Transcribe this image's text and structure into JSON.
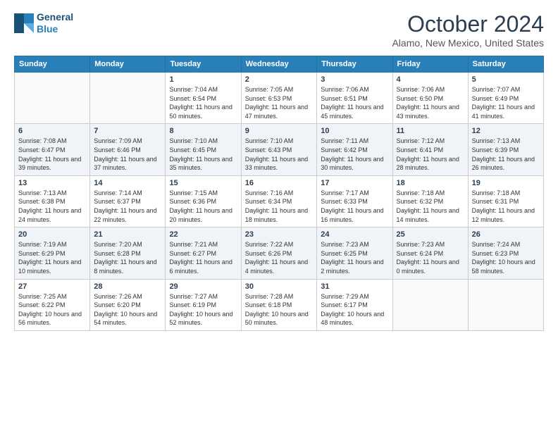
{
  "header": {
    "logo_general": "General",
    "logo_blue": "Blue",
    "month": "October 2024",
    "location": "Alamo, New Mexico, United States"
  },
  "weekdays": [
    "Sunday",
    "Monday",
    "Tuesday",
    "Wednesday",
    "Thursday",
    "Friday",
    "Saturday"
  ],
  "weeks": [
    [
      {
        "day": "",
        "info": ""
      },
      {
        "day": "",
        "info": ""
      },
      {
        "day": "1",
        "info": "Sunrise: 7:04 AM\nSunset: 6:54 PM\nDaylight: 11 hours and 50 minutes."
      },
      {
        "day": "2",
        "info": "Sunrise: 7:05 AM\nSunset: 6:53 PM\nDaylight: 11 hours and 47 minutes."
      },
      {
        "day": "3",
        "info": "Sunrise: 7:06 AM\nSunset: 6:51 PM\nDaylight: 11 hours and 45 minutes."
      },
      {
        "day": "4",
        "info": "Sunrise: 7:06 AM\nSunset: 6:50 PM\nDaylight: 11 hours and 43 minutes."
      },
      {
        "day": "5",
        "info": "Sunrise: 7:07 AM\nSunset: 6:49 PM\nDaylight: 11 hours and 41 minutes."
      }
    ],
    [
      {
        "day": "6",
        "info": "Sunrise: 7:08 AM\nSunset: 6:47 PM\nDaylight: 11 hours and 39 minutes."
      },
      {
        "day": "7",
        "info": "Sunrise: 7:09 AM\nSunset: 6:46 PM\nDaylight: 11 hours and 37 minutes."
      },
      {
        "day": "8",
        "info": "Sunrise: 7:10 AM\nSunset: 6:45 PM\nDaylight: 11 hours and 35 minutes."
      },
      {
        "day": "9",
        "info": "Sunrise: 7:10 AM\nSunset: 6:43 PM\nDaylight: 11 hours and 33 minutes."
      },
      {
        "day": "10",
        "info": "Sunrise: 7:11 AM\nSunset: 6:42 PM\nDaylight: 11 hours and 30 minutes."
      },
      {
        "day": "11",
        "info": "Sunrise: 7:12 AM\nSunset: 6:41 PM\nDaylight: 11 hours and 28 minutes."
      },
      {
        "day": "12",
        "info": "Sunrise: 7:13 AM\nSunset: 6:39 PM\nDaylight: 11 hours and 26 minutes."
      }
    ],
    [
      {
        "day": "13",
        "info": "Sunrise: 7:13 AM\nSunset: 6:38 PM\nDaylight: 11 hours and 24 minutes."
      },
      {
        "day": "14",
        "info": "Sunrise: 7:14 AM\nSunset: 6:37 PM\nDaylight: 11 hours and 22 minutes."
      },
      {
        "day": "15",
        "info": "Sunrise: 7:15 AM\nSunset: 6:36 PM\nDaylight: 11 hours and 20 minutes."
      },
      {
        "day": "16",
        "info": "Sunrise: 7:16 AM\nSunset: 6:34 PM\nDaylight: 11 hours and 18 minutes."
      },
      {
        "day": "17",
        "info": "Sunrise: 7:17 AM\nSunset: 6:33 PM\nDaylight: 11 hours and 16 minutes."
      },
      {
        "day": "18",
        "info": "Sunrise: 7:18 AM\nSunset: 6:32 PM\nDaylight: 11 hours and 14 minutes."
      },
      {
        "day": "19",
        "info": "Sunrise: 7:18 AM\nSunset: 6:31 PM\nDaylight: 11 hours and 12 minutes."
      }
    ],
    [
      {
        "day": "20",
        "info": "Sunrise: 7:19 AM\nSunset: 6:29 PM\nDaylight: 11 hours and 10 minutes."
      },
      {
        "day": "21",
        "info": "Sunrise: 7:20 AM\nSunset: 6:28 PM\nDaylight: 11 hours and 8 minutes."
      },
      {
        "day": "22",
        "info": "Sunrise: 7:21 AM\nSunset: 6:27 PM\nDaylight: 11 hours and 6 minutes."
      },
      {
        "day": "23",
        "info": "Sunrise: 7:22 AM\nSunset: 6:26 PM\nDaylight: 11 hours and 4 minutes."
      },
      {
        "day": "24",
        "info": "Sunrise: 7:23 AM\nSunset: 6:25 PM\nDaylight: 11 hours and 2 minutes."
      },
      {
        "day": "25",
        "info": "Sunrise: 7:23 AM\nSunset: 6:24 PM\nDaylight: 11 hours and 0 minutes."
      },
      {
        "day": "26",
        "info": "Sunrise: 7:24 AM\nSunset: 6:23 PM\nDaylight: 10 hours and 58 minutes."
      }
    ],
    [
      {
        "day": "27",
        "info": "Sunrise: 7:25 AM\nSunset: 6:22 PM\nDaylight: 10 hours and 56 minutes."
      },
      {
        "day": "28",
        "info": "Sunrise: 7:26 AM\nSunset: 6:20 PM\nDaylight: 10 hours and 54 minutes."
      },
      {
        "day": "29",
        "info": "Sunrise: 7:27 AM\nSunset: 6:19 PM\nDaylight: 10 hours and 52 minutes."
      },
      {
        "day": "30",
        "info": "Sunrise: 7:28 AM\nSunset: 6:18 PM\nDaylight: 10 hours and 50 minutes."
      },
      {
        "day": "31",
        "info": "Sunrise: 7:29 AM\nSunset: 6:17 PM\nDaylight: 10 hours and 48 minutes."
      },
      {
        "day": "",
        "info": ""
      },
      {
        "day": "",
        "info": ""
      }
    ]
  ]
}
